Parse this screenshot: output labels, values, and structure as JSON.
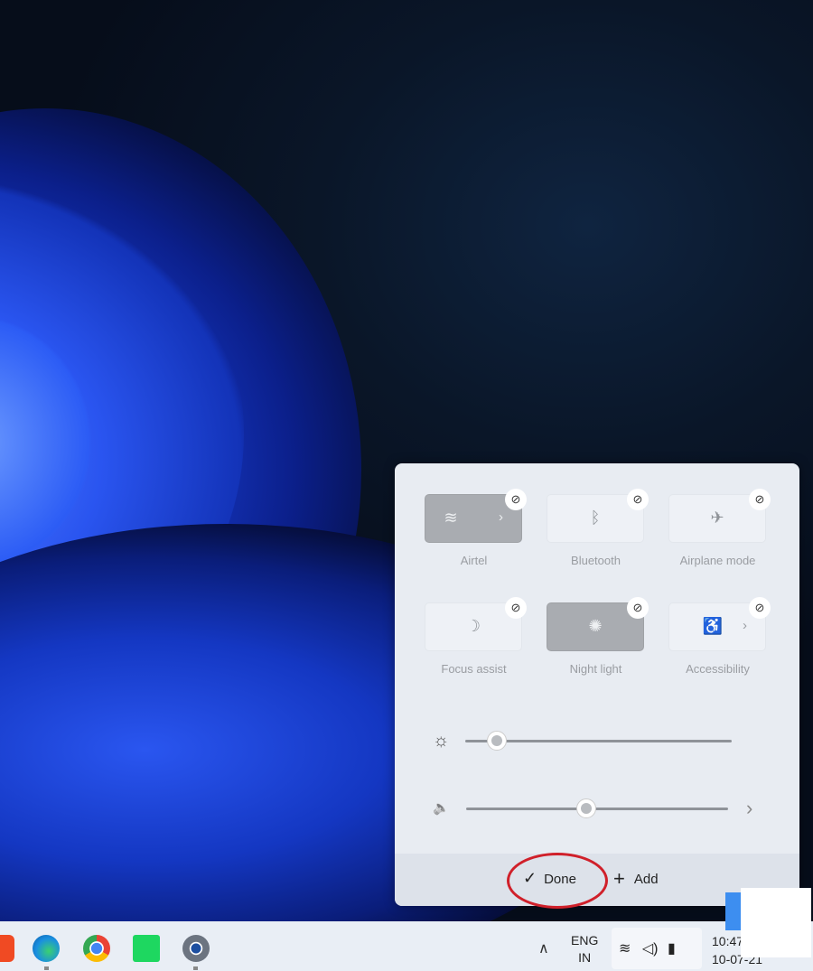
{
  "quick_settings": {
    "tiles": [
      {
        "label": "Airtel",
        "icon": "wifi-icon",
        "glyph": "≋",
        "active": true,
        "has_chevron": true
      },
      {
        "label": "Bluetooth",
        "icon": "bluetooth-icon",
        "glyph": "ᛒ",
        "active": false
      },
      {
        "label": "Airplane mode",
        "icon": "airplane-icon",
        "glyph": "✈",
        "active": false
      },
      {
        "label": "Focus assist",
        "icon": "moon-icon",
        "glyph": "☽",
        "active": false
      },
      {
        "label": "Night light",
        "icon": "night-light-icon",
        "glyph": "✺",
        "active": true
      },
      {
        "label": "Accessibility",
        "icon": "accessibility-icon",
        "glyph": "♿",
        "active": false,
        "has_chevron": true
      }
    ],
    "unpin_glyph": "⊘",
    "brightness": {
      "icon": "sun-icon",
      "glyph": "☼",
      "level_percent": 12
    },
    "volume": {
      "icon": "speaker-icon",
      "glyph": "🔈",
      "level_percent": 46
    },
    "chevron": "›",
    "done_label": "Done",
    "done_glyph": "✓",
    "add_label": "Add",
    "add_glyph": "+"
  },
  "annotation_color": "#d0202a",
  "taskbar": {
    "language_line1": "ENG",
    "language_line2": "IN",
    "chevron_up": "∧",
    "tray_icons": [
      "wifi-icon",
      "speaker-icon",
      "battery-icon"
    ],
    "time": "10:47",
    "date": "10-07-21"
  }
}
